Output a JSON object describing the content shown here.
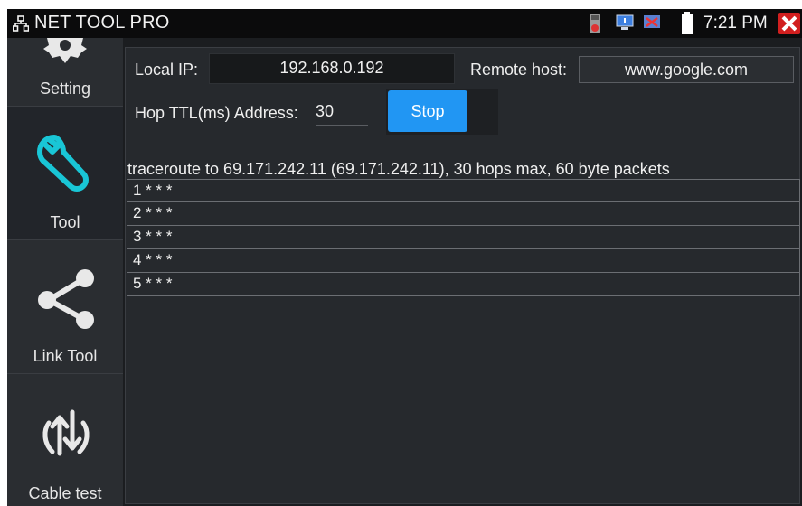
{
  "app": {
    "title": "NET TOOL PRO",
    "clock": "7:21 PM"
  },
  "status_icons": [
    "sd-card-icon",
    "screen-icon",
    "usb-icon",
    "battery-icon"
  ],
  "sidebar": {
    "items": [
      {
        "label": "Setting",
        "icon": "gear-icon"
      },
      {
        "label": "Tool",
        "icon": "wrench-icon"
      },
      {
        "label": "Link Tool",
        "icon": "share-icon"
      },
      {
        "label": "Cable test",
        "icon": "cable-test-icon"
      }
    ]
  },
  "form": {
    "local_ip_label": "Local IP:",
    "local_ip_value": "192.168.0.192",
    "remote_host_label": "Remote host:",
    "remote_host_value": "www.google.com",
    "ttl_label": "Hop TTL(ms) Address:",
    "ttl_value": "30",
    "stop_label": "Stop"
  },
  "trace": {
    "header": "traceroute to 69.171.242.11 (69.171.242.11), 30 hops max, 60 byte packets",
    "rows": [
      "1 * * *",
      "2 * * *",
      "3 * * *",
      "4 * * *",
      "5 * * *"
    ]
  },
  "colors": {
    "accent": "#2196f3",
    "close": "#d11f1f",
    "icon": "#19c6d6"
  }
}
